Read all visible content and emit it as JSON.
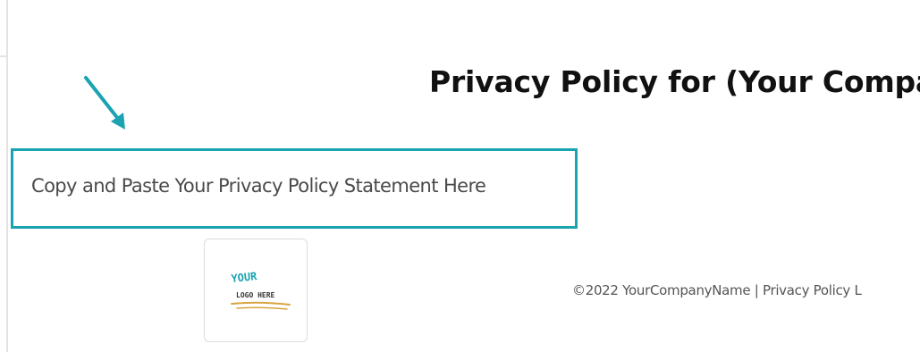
{
  "header": {
    "title": "Privacy Policy for (Your Compa"
  },
  "statement": {
    "text": "Copy and Paste Your Privacy Policy Statement Here"
  },
  "logo": {
    "line1": "YOUR",
    "line2": "LOGO HERE"
  },
  "footer": {
    "text": "©2022 YourCompanyName | Privacy Policy L"
  },
  "colors": {
    "accent": "#1ba3b2",
    "logo_underline": "#d9a441"
  },
  "icons": {
    "pointer": "arrow-icon"
  }
}
